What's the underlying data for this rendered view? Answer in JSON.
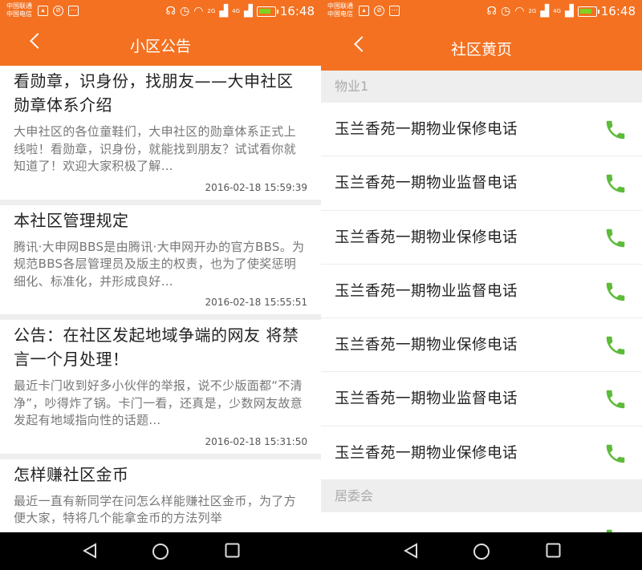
{
  "status": {
    "carrier1": "中国联通",
    "carrier2": "中国电信",
    "net_2g": "2G",
    "net_4g": "4G",
    "time": "16:48"
  },
  "notice_screen": {
    "title": "小区公告",
    "items": [
      {
        "title": "看勋章，识身份，找朋友——大申社区勋章体系介绍",
        "body": "大申社区的各位童鞋们，大申社区的勋章体系正式上线啦！看勋章，识身份，就能找到朋友？试试看你就知道了！欢迎大家积极了解…",
        "date": "2016-02-18 15:59:39"
      },
      {
        "title": "本社区管理规定",
        "body": "腾讯·大申网BBS是由腾讯·大申网开办的官方BBS。为规范BBS各层管理员及版主的权责，也为了使奖惩明细化、标准化，并形成良好…",
        "date": "2016-02-18 15:55:51"
      },
      {
        "title": "公告：在社区发起地域争端的网友 将禁言一个月处理！",
        "body": "最近卡门收到好多小伙伴的举报，说不少版面都“不清净”，吵得炸了锅。卡门一看，还真是，少数网友故意发起有地域指向性的话题…",
        "date": "2016-02-18 15:31:50"
      },
      {
        "title": "怎样赚社区金币",
        "body": "最近一直有新同学在问怎么样能赚社区金币，为了方便大家，特将几个能拿金币的方法列举",
        "date": ""
      }
    ]
  },
  "yellow_pages_screen": {
    "title": "社区黄页",
    "group1": "物业1",
    "rows": [
      {
        "label": "玉兰香苑一期物业保修电话"
      },
      {
        "label": "玉兰香苑一期物业监督电话"
      },
      {
        "label": "玉兰香苑一期物业保修电话"
      },
      {
        "label": "玉兰香苑一期物业监督电话"
      },
      {
        "label": "玉兰香苑一期物业保修电话"
      },
      {
        "label": "玉兰香苑一期物业监督电话"
      },
      {
        "label": "玉兰香苑一期物业保修电话"
      }
    ],
    "group2": "居委会"
  },
  "icons": {
    "phone": "phone-icon",
    "back": "back-icon",
    "nav": [
      "back-triangle-icon",
      "home-circle-icon",
      "recents-square-icon"
    ]
  },
  "colors": {
    "accent": "#f37121",
    "phone_green": "#5dbb3a",
    "separator": "#eeeeee"
  }
}
